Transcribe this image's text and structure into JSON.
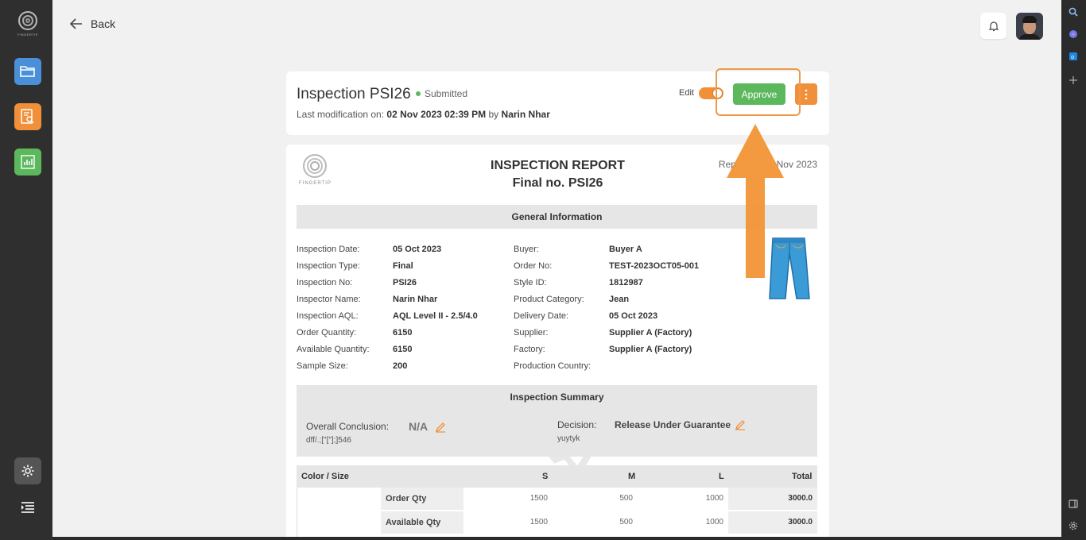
{
  "sidebar": {
    "logo_text": "FINGERTIP",
    "items": [
      {
        "name": "folder",
        "color": "#4a90d9"
      },
      {
        "name": "report-search",
        "color": "#f0903a"
      },
      {
        "name": "chart",
        "color": "#5cb85c"
      }
    ]
  },
  "topbar": {
    "back_label": "Back"
  },
  "header": {
    "title": "Inspection PSI26",
    "status": "Submitted",
    "mod_prefix": "Last modification on:",
    "mod_date": "02 Nov 2023 02:39 PM",
    "mod_by": "by",
    "mod_user": "Narin Nhar",
    "edit_label": "Edit",
    "approve_label": "Approve"
  },
  "report": {
    "logo_text": "FINGERTIP",
    "title": "INSPECTION REPORT",
    "subtitle": "Final no. PSI26",
    "date_prefix": "Rep",
    "date_suffix": "Nov 2023",
    "general_title": "General Information",
    "left_labels": [
      "Inspection Date:",
      "Inspection Type:",
      "Inspection No:",
      "Inspector Name:",
      "Inspection AQL:",
      "Order Quantity:",
      "Available Quantity:",
      "Sample Size:"
    ],
    "left_values": [
      "05 Oct 2023",
      "Final",
      "PSI26",
      "Narin Nhar",
      "AQL Level II - 2.5/4.0",
      "6150",
      "6150",
      "200"
    ],
    "right_labels": [
      "Buyer:",
      "Order No:",
      "Style ID:",
      "Product Category:",
      "Delivery Date:",
      "Supplier:",
      "Factory:",
      "Production Country:"
    ],
    "right_values": [
      "Buyer A",
      "TEST-2023OCT05-001",
      "1812987",
      "Jean",
      "05 Oct 2023",
      "Supplier A (Factory)",
      "Supplier A (Factory)",
      ""
    ],
    "summary": {
      "title": "Inspection Summary",
      "overall_label": "Overall Conclusion:",
      "overall_value": "N/A",
      "overall_note": "dff/.;[\"[\"];]546",
      "decision_label": "Decision:",
      "decision_value": "Release Under Guarantee",
      "decision_note": "yuytyk"
    },
    "table": {
      "headers": [
        "Color / Size",
        "S",
        "M",
        "L",
        "Total"
      ],
      "rows": [
        {
          "label": "Order Qty",
          "s": "1500",
          "m": "500",
          "l": "1000",
          "total": "3000.0"
        },
        {
          "label": "Available Qty",
          "s": "1500",
          "m": "500",
          "l": "1000",
          "total": "3000.0"
        }
      ]
    }
  },
  "colors": {
    "accent_orange": "#f0903a",
    "approve_green": "#5cb85c",
    "folder_blue": "#4a90d9"
  }
}
